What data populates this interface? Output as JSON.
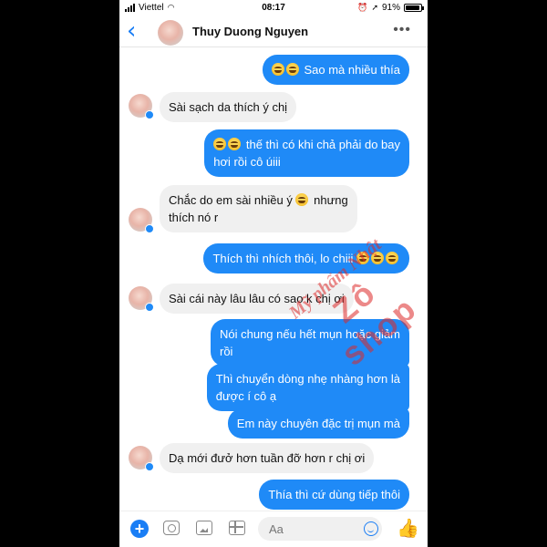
{
  "status": {
    "carrier": "Viettel",
    "time": "08:17",
    "battery": "91%",
    "battery_level": 0.91
  },
  "header": {
    "name": "Thuy Duong Nguyen"
  },
  "messages": [
    {
      "dir": "out",
      "emoji_count": 2,
      "text": "Sao mà nhiều thía"
    },
    {
      "dir": "in",
      "text": "Sài sạch da thích ý chị"
    },
    {
      "dir": "out",
      "emoji_count": 2,
      "line1": "thế thì có khi chả phải do bay",
      "line2": "hơi rồi cô úiii"
    },
    {
      "dir": "in",
      "line1": "Chắc do em sài nhiều ý",
      "line1b": "nhưng",
      "line2": "thích nó r"
    },
    {
      "dir": "out",
      "text": "Thích thì nhích thôi, lo chiii",
      "emoji_count": 3
    },
    {
      "dir": "in",
      "text": "Sài cái này lâu lâu có sao k chị ơi"
    },
    {
      "dir": "out",
      "line1": "Nói chung nếu hết mụn hoặc giảm",
      "line2": "rồi"
    },
    {
      "dir": "out",
      "line1": "Thì chuyển dòng nhẹ nhàng hơn là",
      "line2": "được í cô ạ"
    },
    {
      "dir": "out",
      "text": "Em này chuyên đặc trị mụn mà"
    },
    {
      "dir": "in",
      "text": "Dạ mới đưở hơn tuần đỡ hơn r chị ơi"
    },
    {
      "dir": "out",
      "text": "Thía thì cứ dùng tiếp thôi"
    }
  ],
  "watermark": {
    "line1": "Mỹ phẩm Nhật",
    "line2": "Zô shop"
  },
  "composer": {
    "placeholder": "Aa"
  },
  "colors": {
    "accent": "#1f8af7",
    "incoming": "#f0f0f0"
  }
}
